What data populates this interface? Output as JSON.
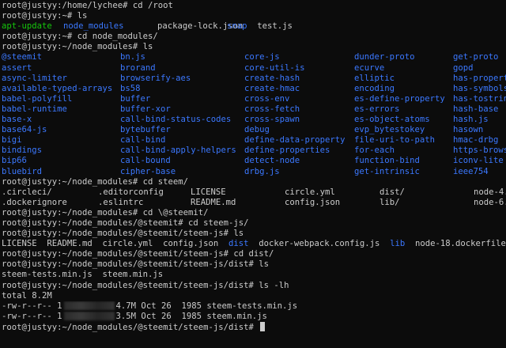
{
  "terminal": {
    "lines": [
      {
        "kind": "cmd",
        "prompt": "root@justyy:/home/lychee# ",
        "command": "cd /root"
      },
      {
        "kind": "cmd",
        "prompt": "root@justyy:~# ",
        "command": "ls"
      },
      {
        "kind": "grid",
        "cols": [
          0,
          78,
          197,
          285
        ],
        "items": [
          {
            "text": "apt-update",
            "color": "green"
          },
          {
            "text": "node_modules",
            "color": "blue"
          },
          {
            "text": "package-lock.json",
            "color": "white"
          },
          {
            "text": "snap  test.js",
            "color": "mixed_snap"
          }
        ]
      },
      {
        "kind": "cmd",
        "prompt": "root@justyy:~# ",
        "command": "cd node_modules/"
      },
      {
        "kind": "cmd",
        "prompt": "root@justyy:~/node_modules# ",
        "command": "ls"
      },
      {
        "kind": "grid",
        "cols": [
          0,
          150,
          307,
          446,
          571
        ],
        "items": [
          {
            "text": "@steemit",
            "color": "blue"
          },
          {
            "text": "bn.js",
            "color": "blue"
          },
          {
            "text": "core-js",
            "color": "blue"
          },
          {
            "text": "dunder-proto",
            "color": "blue"
          },
          {
            "text": "get-proto",
            "color": "blue"
          }
        ]
      },
      {
        "kind": "grid",
        "cols": [
          0,
          150,
          307,
          446,
          571
        ],
        "items": [
          {
            "text": "assert",
            "color": "blue"
          },
          {
            "text": "brorand",
            "color": "blue"
          },
          {
            "text": "core-util-is",
            "color": "blue"
          },
          {
            "text": "ecurve",
            "color": "blue"
          },
          {
            "text": "gopd",
            "color": "blue"
          }
        ]
      },
      {
        "kind": "grid",
        "cols": [
          0,
          150,
          307,
          446,
          571
        ],
        "items": [
          {
            "text": "async-limiter",
            "color": "blue"
          },
          {
            "text": "browserify-aes",
            "color": "blue"
          },
          {
            "text": "create-hash",
            "color": "blue"
          },
          {
            "text": "elliptic",
            "color": "blue"
          },
          {
            "text": "has-propert",
            "color": "blue"
          }
        ]
      },
      {
        "kind": "grid",
        "cols": [
          0,
          150,
          307,
          446,
          571
        ],
        "items": [
          {
            "text": "available-typed-arrays",
            "color": "blue"
          },
          {
            "text": "bs58",
            "color": "blue"
          },
          {
            "text": "create-hmac",
            "color": "blue"
          },
          {
            "text": "encoding",
            "color": "blue"
          },
          {
            "text": "has-symbols",
            "color": "blue"
          }
        ]
      },
      {
        "kind": "grid",
        "cols": [
          0,
          150,
          307,
          446,
          571
        ],
        "items": [
          {
            "text": "babel-polyfill",
            "color": "blue"
          },
          {
            "text": "buffer",
            "color": "blue"
          },
          {
            "text": "cross-env",
            "color": "blue"
          },
          {
            "text": "es-define-property",
            "color": "blue"
          },
          {
            "text": "has-tostrin",
            "color": "blue"
          }
        ]
      },
      {
        "kind": "grid",
        "cols": [
          0,
          150,
          307,
          446,
          571
        ],
        "items": [
          {
            "text": "babel-runtime",
            "color": "blue"
          },
          {
            "text": "buffer-xor",
            "color": "blue"
          },
          {
            "text": "cross-fetch",
            "color": "blue"
          },
          {
            "text": "es-errors",
            "color": "blue"
          },
          {
            "text": "hash-base",
            "color": "blue"
          }
        ]
      },
      {
        "kind": "grid",
        "cols": [
          0,
          150,
          307,
          446,
          571
        ],
        "items": [
          {
            "text": "base-x",
            "color": "blue"
          },
          {
            "text": "call-bind-status-codes",
            "color": "blue"
          },
          {
            "text": "cross-spawn",
            "color": "blue"
          },
          {
            "text": "es-object-atoms",
            "color": "blue"
          },
          {
            "text": "hash.js",
            "color": "blue"
          }
        ]
      },
      {
        "kind": "grid",
        "cols": [
          0,
          150,
          307,
          446,
          571
        ],
        "items": [
          {
            "text": "base64-js",
            "color": "blue"
          },
          {
            "text": "bytebuffer",
            "color": "blue"
          },
          {
            "text": "debug",
            "color": "blue"
          },
          {
            "text": "evp_bytestokey",
            "color": "blue"
          },
          {
            "text": "hasown",
            "color": "blue"
          }
        ]
      },
      {
        "kind": "grid",
        "cols": [
          0,
          150,
          307,
          446,
          571
        ],
        "items": [
          {
            "text": "bigi",
            "color": "blue"
          },
          {
            "text": "call-bind",
            "color": "blue"
          },
          {
            "text": "define-data-property",
            "color": "blue"
          },
          {
            "text": "file-uri-to-path",
            "color": "blue"
          },
          {
            "text": "hmac-drbg",
            "color": "blue"
          }
        ]
      },
      {
        "kind": "grid",
        "cols": [
          0,
          150,
          307,
          446,
          571
        ],
        "items": [
          {
            "text": "bindings",
            "color": "blue"
          },
          {
            "text": "call-bind-apply-helpers",
            "color": "blue"
          },
          {
            "text": "define-properties",
            "color": "blue"
          },
          {
            "text": "for-each",
            "color": "blue"
          },
          {
            "text": "https-brows",
            "color": "blue"
          }
        ]
      },
      {
        "kind": "grid",
        "cols": [
          0,
          150,
          307,
          446,
          571
        ],
        "items": [
          {
            "text": "bip66",
            "color": "blue"
          },
          {
            "text": "call-bound",
            "color": "blue"
          },
          {
            "text": "detect-node",
            "color": "blue"
          },
          {
            "text": "function-bind",
            "color": "blue"
          },
          {
            "text": "iconv-lite",
            "color": "blue"
          }
        ]
      },
      {
        "kind": "grid",
        "cols": [
          0,
          150,
          307,
          446,
          571
        ],
        "items": [
          {
            "text": "bluebird",
            "color": "blue"
          },
          {
            "text": "cipher-base",
            "color": "blue"
          },
          {
            "text": "drbg.js",
            "color": "blue"
          },
          {
            "text": "get-intrinsic",
            "color": "blue"
          },
          {
            "text": "ieee754",
            "color": "blue"
          }
        ]
      },
      {
        "kind": "cmd",
        "prompt": "root@justyy:~/node_modules# ",
        "command": "cd steem/"
      },
      {
        "kind": "grid",
        "cols": [
          0,
          122,
          239,
          358,
          478,
          597
        ],
        "items": [
          {
            "text": ".circleci/",
            "color": "white"
          },
          {
            "text": ".editorconfig",
            "color": "white"
          },
          {
            "text": "LICENSE",
            "color": "white"
          },
          {
            "text": "circle.yml",
            "color": "white"
          },
          {
            "text": "dist/",
            "color": "white"
          },
          {
            "text": "node-4.",
            "color": "white"
          }
        ]
      },
      {
        "kind": "grid",
        "cols": [
          0,
          122,
          239,
          358,
          478,
          597
        ],
        "items": [
          {
            "text": ".dockerignore",
            "color": "white"
          },
          {
            "text": ".eslintrc",
            "color": "white"
          },
          {
            "text": "README.md",
            "color": "white"
          },
          {
            "text": "config.json",
            "color": "white"
          },
          {
            "text": "lib/",
            "color": "white"
          },
          {
            "text": "node-6.",
            "color": "white"
          }
        ]
      },
      {
        "kind": "cmd",
        "prompt": "root@justyy:~/node_modules# ",
        "command": "cd \\@steemit/"
      },
      {
        "kind": "cmd",
        "prompt": "root@justyy:~/node_modules/@steemit# ",
        "command": "cd steem-js/"
      },
      {
        "kind": "cmd",
        "prompt": "root@justyy:~/node_modules/@steemit/steem-js# ",
        "command": "ls"
      },
      {
        "kind": "flow",
        "items": [
          {
            "text": "LICENSE  README.md  circle.yml  config.json  ",
            "color": "white"
          },
          {
            "text": "dist",
            "color": "blue"
          },
          {
            "text": "  docker-webpack.config.js  ",
            "color": "white"
          },
          {
            "text": "lib",
            "color": "blue"
          },
          {
            "text": "  node-18.dockerfile",
            "color": "white"
          }
        ]
      },
      {
        "kind": "cmd",
        "prompt": "root@justyy:~/node_modules/@steemit/steem-js# ",
        "command": "cd dist/"
      },
      {
        "kind": "cmd",
        "prompt": "root@justyy:~/node_modules/@steemit/steem-js/dist# ",
        "command": "ls"
      },
      {
        "kind": "plain",
        "text": "steem-tests.min.js  steem.min.js"
      },
      {
        "kind": "cmd",
        "prompt": "root@justyy:~/node_modules/@steemit/steem-js/dist# ",
        "command": "ls -lh"
      },
      {
        "kind": "plain",
        "text": "total 8.2M"
      },
      {
        "kind": "lsl",
        "perm": "-rw-r--r-- 1",
        "rest": "4.7M Oct 26  1985 steem-tests.min.js"
      },
      {
        "kind": "lsl",
        "perm": "-rw-r--r-- 1",
        "rest": "3.5M Oct 26  1985 steem.min.js"
      },
      {
        "kind": "cmd",
        "prompt": "root@justyy:~/node_modules/@steemit/steem-js/dist# ",
        "command": "",
        "cursor": true
      }
    ]
  }
}
